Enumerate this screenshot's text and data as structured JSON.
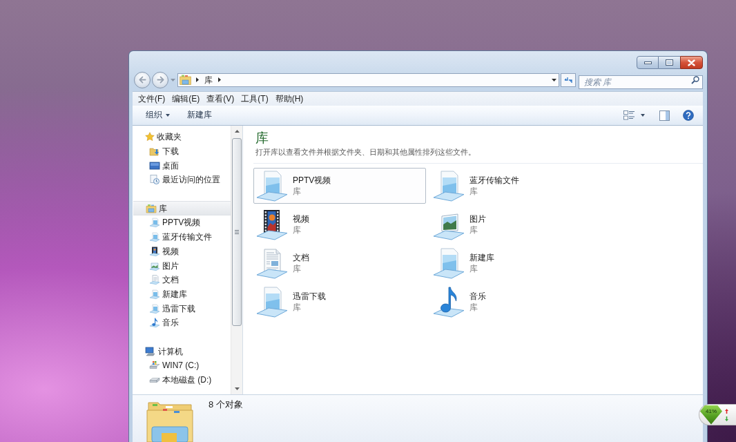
{
  "address_bar": {
    "path": [
      "库"
    ]
  },
  "search": {
    "placeholder": "搜索 库"
  },
  "menu": [
    "文件(F)",
    "编辑(E)",
    "查看(V)",
    "工具(T)",
    "帮助(H)"
  ],
  "toolbar": {
    "buttons": [
      {
        "label": "组织",
        "dropdown": true
      },
      {
        "label": "新建库",
        "dropdown": false
      }
    ]
  },
  "sidebar": {
    "groups": [
      {
        "label": "收藏夹",
        "kind": "favorites",
        "selected": false,
        "children": [
          {
            "label": "下载",
            "kind": "downloads",
            "selected": false
          },
          {
            "label": "桌面",
            "kind": "desktop",
            "selected": false
          },
          {
            "label": "最近访问的位置",
            "kind": "recent",
            "selected": false
          }
        ]
      },
      {
        "label": "库",
        "kind": "libraries",
        "selected": true,
        "children": [
          {
            "label": "PPTV视频",
            "kind": "library",
            "selected": false
          },
          {
            "label": "蓝牙传输文件",
            "kind": "library",
            "selected": false
          },
          {
            "label": "视频",
            "kind": "video",
            "selected": false
          },
          {
            "label": "图片",
            "kind": "pictures",
            "selected": false
          },
          {
            "label": "文档",
            "kind": "documents",
            "selected": false
          },
          {
            "label": "新建库",
            "kind": "library",
            "selected": false
          },
          {
            "label": "迅雷下载",
            "kind": "library",
            "selected": false
          },
          {
            "label": "音乐",
            "kind": "music",
            "selected": false
          }
        ]
      },
      {
        "label": "计算机",
        "kind": "computer",
        "selected": false,
        "children": [
          {
            "label": "WIN7 (C:)",
            "kind": "system-drive",
            "selected": false
          },
          {
            "label": "本地磁盘 (D:)",
            "kind": "drive",
            "selected": false
          }
        ]
      }
    ]
  },
  "content": {
    "heading": "库",
    "description": "打开库以查看文件并根据文件夹、日期和其他属性排列这些文件。",
    "items": [
      {
        "name": "PPTV视频",
        "subtitle": "库",
        "kind": "library",
        "selected": true
      },
      {
        "name": "蓝牙传输文件",
        "subtitle": "库",
        "kind": "library",
        "selected": false
      },
      {
        "name": "视频",
        "subtitle": "库",
        "kind": "video",
        "selected": false
      },
      {
        "name": "图片",
        "subtitle": "库",
        "kind": "pictures",
        "selected": false
      },
      {
        "name": "文档",
        "subtitle": "库",
        "kind": "documents",
        "selected": false
      },
      {
        "name": "新建库",
        "subtitle": "库",
        "kind": "library",
        "selected": false
      },
      {
        "name": "迅雷下载",
        "subtitle": "库",
        "kind": "library",
        "selected": false
      },
      {
        "name": "音乐",
        "subtitle": "库",
        "kind": "music",
        "selected": false
      }
    ]
  },
  "details": {
    "summary": "8 个对象"
  },
  "tray_widget": {
    "label": "41%"
  }
}
